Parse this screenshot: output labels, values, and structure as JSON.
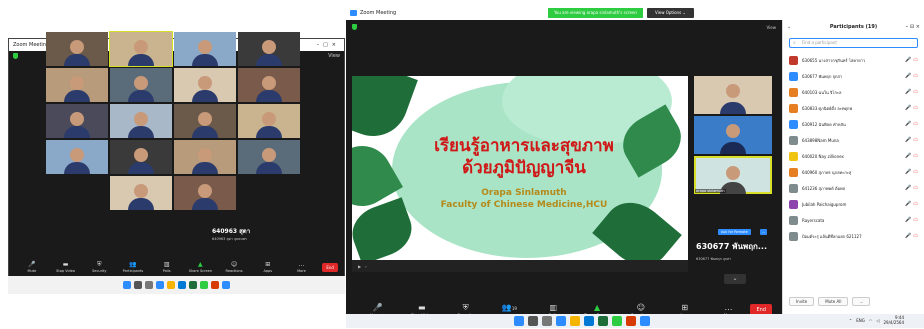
{
  "left": {
    "title": "Zoom Meeting",
    "view_label": "View",
    "tiles": [
      [
        "",
        "",
        "",
        ""
      ],
      [
        "",
        "",
        "",
        ""
      ],
      [
        "",
        "",
        "",
        ""
      ],
      [
        "",
        "",
        "",
        ""
      ],
      [
        "",
        "",
        "",
        ""
      ]
    ],
    "big_name": "640963 สุดา",
    "big_sub": "640963 สุดา จุลธนพร",
    "toolbar": [
      "Mute",
      "Stop Video",
      "Security",
      "Participants",
      "Polls",
      "Share Screen",
      "Reactions",
      "Apps",
      "More"
    ],
    "end_label": "End"
  },
  "right": {
    "title": "Zoom Meeting",
    "banner_msg": "You are viewing orapa sinlamuth's screen",
    "banner_opt": "View Options ⌄",
    "view_label": "View",
    "slide": {
      "title1": "เรียนรู้อาหารและสุขภาพ",
      "title2": "ด้วยภูมิปัญญาจีน",
      "author": "Orapa  Sinlamuth",
      "faculty": "Faculty of Chinese Medicine,HCU"
    },
    "thumbs": [
      "",
      "",
      "orapa sinlamuth"
    ],
    "thumb_badge": "Ask for Remote",
    "thumb_more": "...",
    "big_name": "630677 พันพฤก...",
    "big_sub": "630677 พันพฤก จุกสา",
    "toolbar": [
      "Unmute",
      "Stop Video",
      "Security",
      "Participants",
      "Polls",
      "Share Screen",
      "Reactions",
      "Apps",
      "More"
    ],
    "toolbar_badge": "19",
    "end_label": "End",
    "clock_time": "9:44",
    "clock_date": "29/4/2564",
    "tray_lang": "ENG"
  },
  "panel": {
    "title": "Participants (19)",
    "search_placeholder": "Find a participant",
    "participants": [
      {
        "name": "630655 นางสาวกชุกันทร์ โสคายาว",
        "color": "#c0392b"
      },
      {
        "name": "630677 พันพฤก จุกสา",
        "color": "#2d8cff"
      },
      {
        "name": "640103 ฉนใน จิโกะล",
        "color": "#e67e22"
      },
      {
        "name": "630833 ศุภนิตย์ตั้ง ละทดุกพ",
        "color": "#e67e22"
      },
      {
        "name": "630912 ฉันพิลด คำหลัน",
        "color": "#2d8cff"
      },
      {
        "name": "643898Nam Muna",
        "color": "#7f8c8d"
      },
      {
        "name": "640020 Nay zillionex",
        "color": "#f1c40f"
      },
      {
        "name": "640960 สุภาพร นุกลทะกะสุ",
        "color": "#e67e22"
      },
      {
        "name": "641236 สุภาพคด์ ต้อพล",
        "color": "#7f8c8d"
      },
      {
        "name": "Jubilah Paichaiguprom",
        "color": "#8e44ad"
      },
      {
        "name": "Rayerscata",
        "color": "#7f8c8d"
      },
      {
        "name": "ป้อมต์ระรุ่ แล้นดีที่ลกแยก 621127",
        "color": "#7f8c8d"
      }
    ],
    "invite_label": "Invite",
    "mute_all_label": "Mute All",
    "more_label": "..."
  }
}
